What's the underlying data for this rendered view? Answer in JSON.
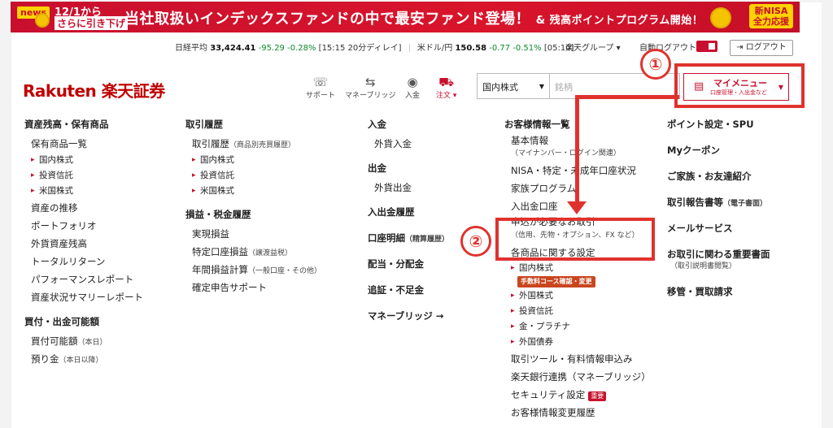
{
  "banner": {
    "news": "news",
    "date": "12/1から",
    "sub": "さらに引き下げ",
    "main": "当社取扱いインデックスファンドの中で最安ファンド登場！",
    "main2": "& 残高ポイントプログラム開始！",
    "nisa1": "新NISA",
    "nisa2": "全力応援"
  },
  "ticker": {
    "nikkei_label": "日経平均",
    "nikkei_value": "33,424.41",
    "nikkei_change": "-95.29 -0.28%",
    "nikkei_time": "[15:15 20分ディレイ]",
    "usd_label": "米ドル/円",
    "usd_value": "150.58",
    "usd_change": "-0.77 -0.51%",
    "usd_time": "[05:10]",
    "group": "楽天グループ ▾",
    "autologout": "自動ログアウト",
    "logout": "ログアウト"
  },
  "header": {
    "logo": "Rakuten 楽天証券",
    "icons": [
      {
        "label": "サポート"
      },
      {
        "label": "マネーブリッジ"
      },
      {
        "label": "入金"
      },
      {
        "label": "注文 ▾"
      }
    ],
    "market_select": "国内株式",
    "search_placeholder": "銘柄",
    "mymenu_title": "マイメニュー",
    "mymenu_sub": "口座管理・入出金など"
  },
  "annotations": {
    "one": "①",
    "two": "②"
  },
  "col1": {
    "h1": "資産残高・保有商品",
    "it1": "保有商品一覧",
    "subs": [
      "国内株式",
      "投資信託",
      "米国株式"
    ],
    "items": [
      "資産の推移",
      "ポートフォリオ",
      "外貨資産残高",
      "トータルリターン",
      "パフォーマンスレポート",
      "資産状況サマリーレポート"
    ],
    "h2": "買付・出金可能額",
    "it_buy": "買付可能額",
    "it_buy_note": "（本日）",
    "it_dep": "預り金",
    "it_dep_note": "（本日以降）"
  },
  "col2": {
    "h1": "取引履歴",
    "it1": "取引履歴",
    "it1_note": "（商品別売買履歴）",
    "subs": [
      "国内株式",
      "投資信託",
      "米国株式"
    ],
    "h2": "損益・税金履歴",
    "it_pl": "実現損益",
    "it_sp": "特定口座損益",
    "it_sp_note": "（譲渡益税）",
    "it_year": "年間損益計算",
    "it_year_note": "（一般口座・その他）",
    "it_tax": "確定申告サポート"
  },
  "col3": {
    "h1": "入金",
    "it1": "外貨入金",
    "h2": "出金",
    "it2": "外貨出金",
    "h3": "入出金履歴",
    "h4": "口座明細",
    "h4_note": "（精算履歴）",
    "h5": "配当・分配金",
    "h6": "追証・不足金",
    "h7": "マネーブリッジ →"
  },
  "col4": {
    "h1": "お客様情報一覧",
    "basic": "基本情報",
    "basic_note": "（マイナンバー・ログイン関連）",
    "nisa": "NISA・特定・未成年口座状況",
    "family": "家族プログラム",
    "open": "入出金口座",
    "apply": "申込が必要なお取引",
    "apply_note": "（信用、先物・オプション、FX など）",
    "settings": "各商品に関する設定",
    "dom": "国内株式",
    "fee_tag": "手数料コース確認・変更",
    "subs": [
      "外国株式",
      "投資信託",
      "金・プラチナ",
      "外国債券"
    ],
    "tools": "取引ツール・有料情報申込み",
    "bank": "楽天銀行連携（マネーブリッジ）",
    "security": "セキュリティ設定",
    "security_tag": "重要",
    "more": "お客様情報変更履歴"
  },
  "col5": {
    "h1": "ポイント設定・SPU",
    "h2": "Myクーポン",
    "h3": "ご家族・お友達紹介",
    "h4": "取引報告書等",
    "h4_note": "（電子書面）",
    "h5": "メールサービス",
    "h6": "お取引に関わる重要書面",
    "h6_note": "（取引説明書閲覧）",
    "h7": "移管・買取請求"
  },
  "colors": {
    "brand": "#bf0000",
    "annotation": "#e0322d"
  }
}
